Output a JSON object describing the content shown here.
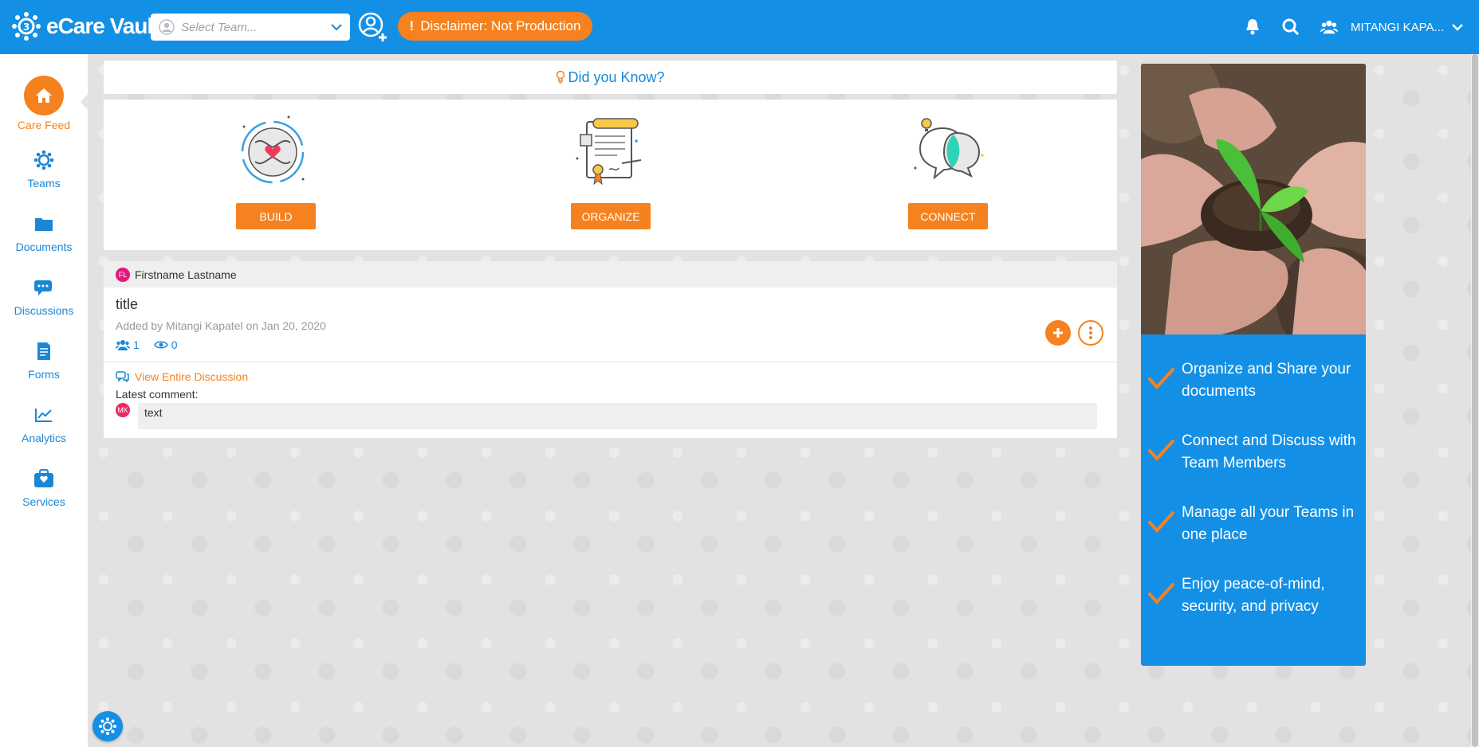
{
  "header": {
    "logo_text": "eCare Vault",
    "team_select_placeholder": "Select Team...",
    "disclaimer": "Disclaimer: Not Production",
    "user_name": "MITANGI KAPA...",
    "brand_color": "#1390e6",
    "accent_color": "#f5821f"
  },
  "sidebar": {
    "items": [
      {
        "label": "Care Feed",
        "icon": "home-icon"
      },
      {
        "label": "Teams",
        "icon": "teams-icon"
      },
      {
        "label": "Documents",
        "icon": "folder-icon"
      },
      {
        "label": "Discussions",
        "icon": "chat-icon"
      },
      {
        "label": "Forms",
        "icon": "form-icon"
      },
      {
        "label": "Analytics",
        "icon": "chart-icon"
      },
      {
        "label": "Services",
        "icon": "services-icon"
      }
    ]
  },
  "did_you_know": {
    "label": "Did you Know?"
  },
  "features": [
    {
      "label": "BUILD",
      "icon": "hands-heart-icon"
    },
    {
      "label": "ORGANIZE",
      "icon": "document-icon"
    },
    {
      "label": "CONNECT",
      "icon": "chat-bubbles-icon"
    }
  ],
  "post": {
    "author_initials": "FL",
    "author_name": "Firstname Lastname",
    "title": "title",
    "meta": "Added by Mitangi Kapatel on Jan 20, 2020",
    "members_count": "1",
    "views_count": "0",
    "view_link": "View Entire Discussion",
    "latest_label": "Latest comment:",
    "comment_initials": "MK",
    "comment_text": "text"
  },
  "promo": {
    "items": [
      "Organize and Share your documents",
      "Connect and Discuss with Team Members",
      "Manage all your Teams in one place",
      "Enjoy peace-of-mind, security, and privacy"
    ]
  }
}
